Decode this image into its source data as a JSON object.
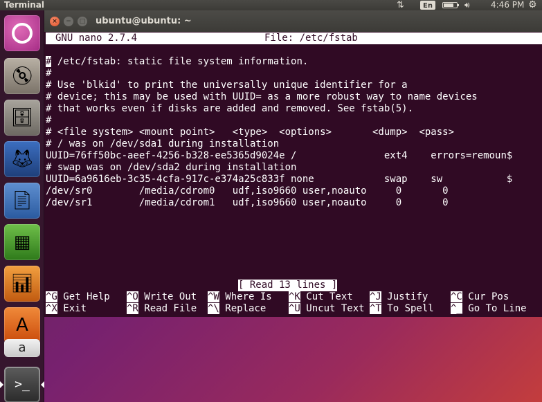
{
  "top_panel": {
    "app_name": "Terminal",
    "keyboard_layout": "En",
    "battery_level_pct": 80,
    "time": "4:46 PM",
    "icons": [
      "network-icon",
      "keyboard-icon",
      "battery-icon",
      "volume-icon",
      "gear-icon"
    ]
  },
  "launcher": {
    "items": [
      {
        "name": "ubuntu-dash",
        "icon": "ubuntu-logo-icon"
      },
      {
        "name": "install-ubuntu",
        "icon": "installer-icon"
      },
      {
        "name": "files",
        "icon": "files-icon"
      },
      {
        "name": "firefox",
        "icon": "firefox-icon"
      },
      {
        "name": "libreoffice-writer",
        "icon": "writer-icon"
      },
      {
        "name": "libreoffice-calc",
        "icon": "calc-icon"
      },
      {
        "name": "libreoffice-impress",
        "icon": "impress-icon"
      },
      {
        "name": "ubuntu-software",
        "icon": "software-center-icon"
      },
      {
        "name": "amazon",
        "icon": "amazon-icon"
      },
      {
        "name": "terminal",
        "icon": "terminal-icon",
        "active": true
      }
    ],
    "amazon_text": "a"
  },
  "window": {
    "title": "ubuntu@ubuntu: ~",
    "buttons": {
      "close": "×",
      "minimize": "−",
      "maximize": "□"
    }
  },
  "nano": {
    "version": "GNU nano 2.7.4",
    "file_label": "File: /etc/fstab",
    "cursor_char": "#",
    "lines": [
      " /etc/fstab: static file system information.",
      "#",
      "# Use 'blkid' to print the universally unique identifier for a",
      "# device; this may be used with UUID= as a more robust way to name devices",
      "# that works even if disks are added and removed. See fstab(5).",
      "#",
      "# <file system> <mount point>   <type>  <options>       <dump>  <pass>",
      "# / was on /dev/sda1 during installation",
      "UUID=76ff50bc-aeef-4256-b328-ee5365d9024e /               ext4    errors=remoun$",
      "# swap was on /dev/sda2 during installation",
      "UUID=6a9616eb-3c35-4cfa-917c-e374a25c833f none            swap    sw           $",
      "/dev/sr0        /media/cdrom0   udf,iso9660 user,noauto     0       0",
      "/dev/sr1        /media/cdrom1   udf,iso9660 user,noauto     0       0"
    ],
    "status_message": "[ Read 13 lines ]",
    "shortcuts_row1": [
      {
        "key": "^G",
        "label": " Get Help"
      },
      {
        "key": "^O",
        "label": " Write Out"
      },
      {
        "key": "^W",
        "label": " Where Is"
      },
      {
        "key": "^K",
        "label": " Cut Text"
      },
      {
        "key": "^J",
        "label": " Justify"
      },
      {
        "key": "^C",
        "label": " Cur Pos"
      }
    ],
    "shortcuts_row2": [
      {
        "key": "^X",
        "label": " Exit"
      },
      {
        "key": "^R",
        "label": " Read File"
      },
      {
        "key": "^\\",
        "label": " Replace"
      },
      {
        "key": "^U",
        "label": " Uncut Text"
      },
      {
        "key": "^T",
        "label": " To Spell"
      },
      {
        "key": "^_",
        "label": " Go To Line"
      }
    ]
  },
  "colors": {
    "terminal_bg": "#300a24",
    "terminal_fg": "#ffffff",
    "panel_bg": "#3c3b37",
    "close_button": "#e0522b"
  }
}
